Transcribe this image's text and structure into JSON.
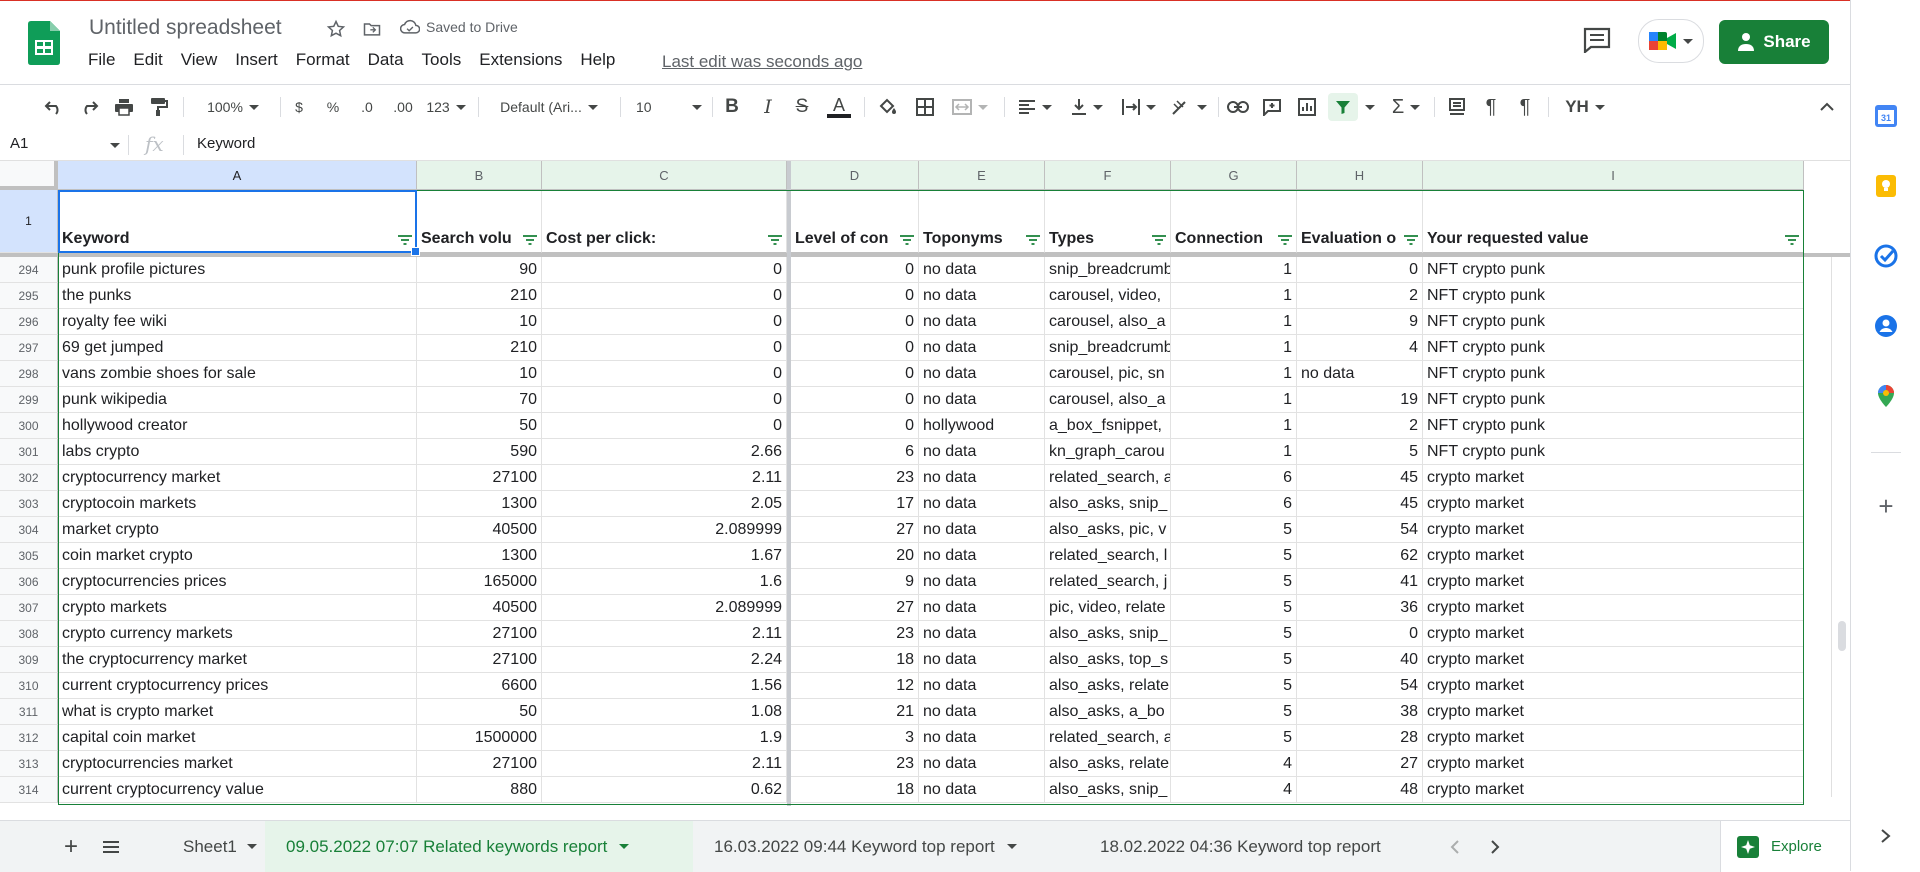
{
  "doc": {
    "title": "Untitled spreadsheet",
    "saved_status": "Saved to Drive",
    "last_edit": "Last edit was seconds ago"
  },
  "menu": [
    "File",
    "Edit",
    "View",
    "Insert",
    "Format",
    "Data",
    "Tools",
    "Extensions",
    "Help"
  ],
  "share_label": "Share",
  "toolbar": {
    "zoom": "100%",
    "currency": "$",
    "percent": "%",
    "dec_decrease": ".0",
    "dec_increase": ".00",
    "more_formats": "123",
    "font": "Default (Ari...",
    "font_size": "10",
    "text_color": "#202124",
    "filter_color": "#188038"
  },
  "formula_bar": {
    "cell_ref": "A1",
    "fx": "fx",
    "content": "Keyword"
  },
  "columns": [
    "A",
    "B",
    "C",
    "D",
    "E",
    "F",
    "G",
    "H",
    "I"
  ],
  "header_row_number": "1",
  "headers": [
    "Keyword",
    "Search volu",
    "Cost per click:",
    "Level of con",
    "Toponyms",
    "Types",
    "Connection",
    "Evaluation o",
    "Your requested value"
  ],
  "rows": [
    {
      "n": "294",
      "a": "punk profile pictures",
      "b": "90",
      "c": "0",
      "d": "0",
      "e": "no data",
      "f": "snip_breadcrumb",
      "g": "1",
      "h": "0",
      "i": "NFT crypto punk"
    },
    {
      "n": "295",
      "a": "the punks",
      "b": "210",
      "c": "0",
      "d": "0",
      "e": "no data",
      "f": "carousel, video,",
      "g": "1",
      "h": "2",
      "i": "NFT crypto punk"
    },
    {
      "n": "296",
      "a": "royalty fee wiki",
      "b": "10",
      "c": "0",
      "d": "0",
      "e": "no data",
      "f": "carousel, also_a",
      "g": "1",
      "h": "9",
      "i": "NFT crypto punk"
    },
    {
      "n": "297",
      "a": "69 get jumped",
      "b": "210",
      "c": "0",
      "d": "0",
      "e": "no data",
      "f": "snip_breadcrumb",
      "g": "1",
      "h": "4",
      "i": "NFT crypto punk"
    },
    {
      "n": "298",
      "a": "vans zombie shoes for sale",
      "b": "10",
      "c": "0",
      "d": "0",
      "e": "no data",
      "f": "carousel, pic, sn",
      "g": "1",
      "h": "no data",
      "i": "NFT crypto punk"
    },
    {
      "n": "299",
      "a": "punk wikipedia",
      "b": "70",
      "c": "0",
      "d": "0",
      "e": "no data",
      "f": "carousel, also_a",
      "g": "1",
      "h": "19",
      "i": "NFT crypto punk"
    },
    {
      "n": "300",
      "a": "hollywood creator",
      "b": "50",
      "c": "0",
      "d": "0",
      "e": "hollywood",
      "f": "a_box_fsnippet,",
      "g": "1",
      "h": "2",
      "i": "NFT crypto punk"
    },
    {
      "n": "301",
      "a": "labs crypto",
      "b": "590",
      "c": "2.66",
      "d": "6",
      "e": "no data",
      "f": "kn_graph_carou",
      "g": "1",
      "h": "5",
      "i": "NFT crypto punk"
    },
    {
      "n": "302",
      "a": "cryptocurrency market",
      "b": "27100",
      "c": "2.11",
      "d": "23",
      "e": "no data",
      "f": "related_search, a",
      "g": "6",
      "h": "45",
      "i": "crypto market"
    },
    {
      "n": "303",
      "a": "cryptocoin markets",
      "b": "1300",
      "c": "2.05",
      "d": "17",
      "e": "no data",
      "f": "also_asks, snip_",
      "g": "6",
      "h": "45",
      "i": "crypto market"
    },
    {
      "n": "304",
      "a": "market crypto",
      "b": "40500",
      "c": "2.089999",
      "d": "27",
      "e": "no data",
      "f": "also_asks, pic, v",
      "g": "5",
      "h": "54",
      "i": "crypto market"
    },
    {
      "n": "305",
      "a": "coin market crypto",
      "b": "1300",
      "c": "1.67",
      "d": "20",
      "e": "no data",
      "f": "related_search, l",
      "g": "5",
      "h": "62",
      "i": "crypto market"
    },
    {
      "n": "306",
      "a": "cryptocurrencies prices",
      "b": "165000",
      "c": "1.6",
      "d": "9",
      "e": "no data",
      "f": "related_search, j",
      "g": "5",
      "h": "41",
      "i": "crypto market"
    },
    {
      "n": "307",
      "a": "crypto markets",
      "b": "40500",
      "c": "2.089999",
      "d": "27",
      "e": "no data",
      "f": "pic, video, relate",
      "g": "5",
      "h": "36",
      "i": "crypto market"
    },
    {
      "n": "308",
      "a": "crypto currency markets",
      "b": "27100",
      "c": "2.11",
      "d": "23",
      "e": "no data",
      "f": "also_asks, snip_",
      "g": "5",
      "h": "0",
      "i": "crypto market"
    },
    {
      "n": "309",
      "a": "the cryptocurrency market",
      "b": "27100",
      "c": "2.24",
      "d": "18",
      "e": "no data",
      "f": "also_asks, top_s",
      "g": "5",
      "h": "40",
      "i": "crypto market"
    },
    {
      "n": "310",
      "a": "current cryptocurrency prices",
      "b": "6600",
      "c": "1.56",
      "d": "12",
      "e": "no data",
      "f": "also_asks, relate",
      "g": "5",
      "h": "54",
      "i": "crypto market"
    },
    {
      "n": "311",
      "a": "what is crypto market",
      "b": "50",
      "c": "1.08",
      "d": "21",
      "e": "no data",
      "f": "also_asks, a_bo",
      "g": "5",
      "h": "38",
      "i": "crypto market"
    },
    {
      "n": "312",
      "a": "capital coin market",
      "b": "1500000",
      "c": "1.9",
      "d": "3",
      "e": "no data",
      "f": "related_search, a",
      "g": "5",
      "h": "28",
      "i": "crypto market"
    },
    {
      "n": "313",
      "a": "cryptocurrencies market",
      "b": "27100",
      "c": "2.11",
      "d": "23",
      "e": "no data",
      "f": "also_asks, relate",
      "g": "4",
      "h": "27",
      "i": "crypto market"
    },
    {
      "n": "314",
      "a": "current cryptocurrency value",
      "b": "880",
      "c": "0.62",
      "d": "18",
      "e": "no data",
      "f": "also_asks, snip_",
      "g": "4",
      "h": "48",
      "i": "crypto market"
    }
  ],
  "sheets": [
    {
      "label": "Sheet1",
      "active": false
    },
    {
      "label": "09.05.2022 07:07 Related keywords report",
      "active": true
    },
    {
      "label": "16.03.2022 09:44 Keyword top report",
      "active": false
    },
    {
      "label": "18.02.2022 04:36 Keyword top report",
      "active": false
    }
  ],
  "explore_label": "Explore",
  "side_icons": [
    "calendar-icon",
    "keep-icon",
    "tasks-icon",
    "contacts-icon",
    "maps-icon",
    "add-icon"
  ]
}
